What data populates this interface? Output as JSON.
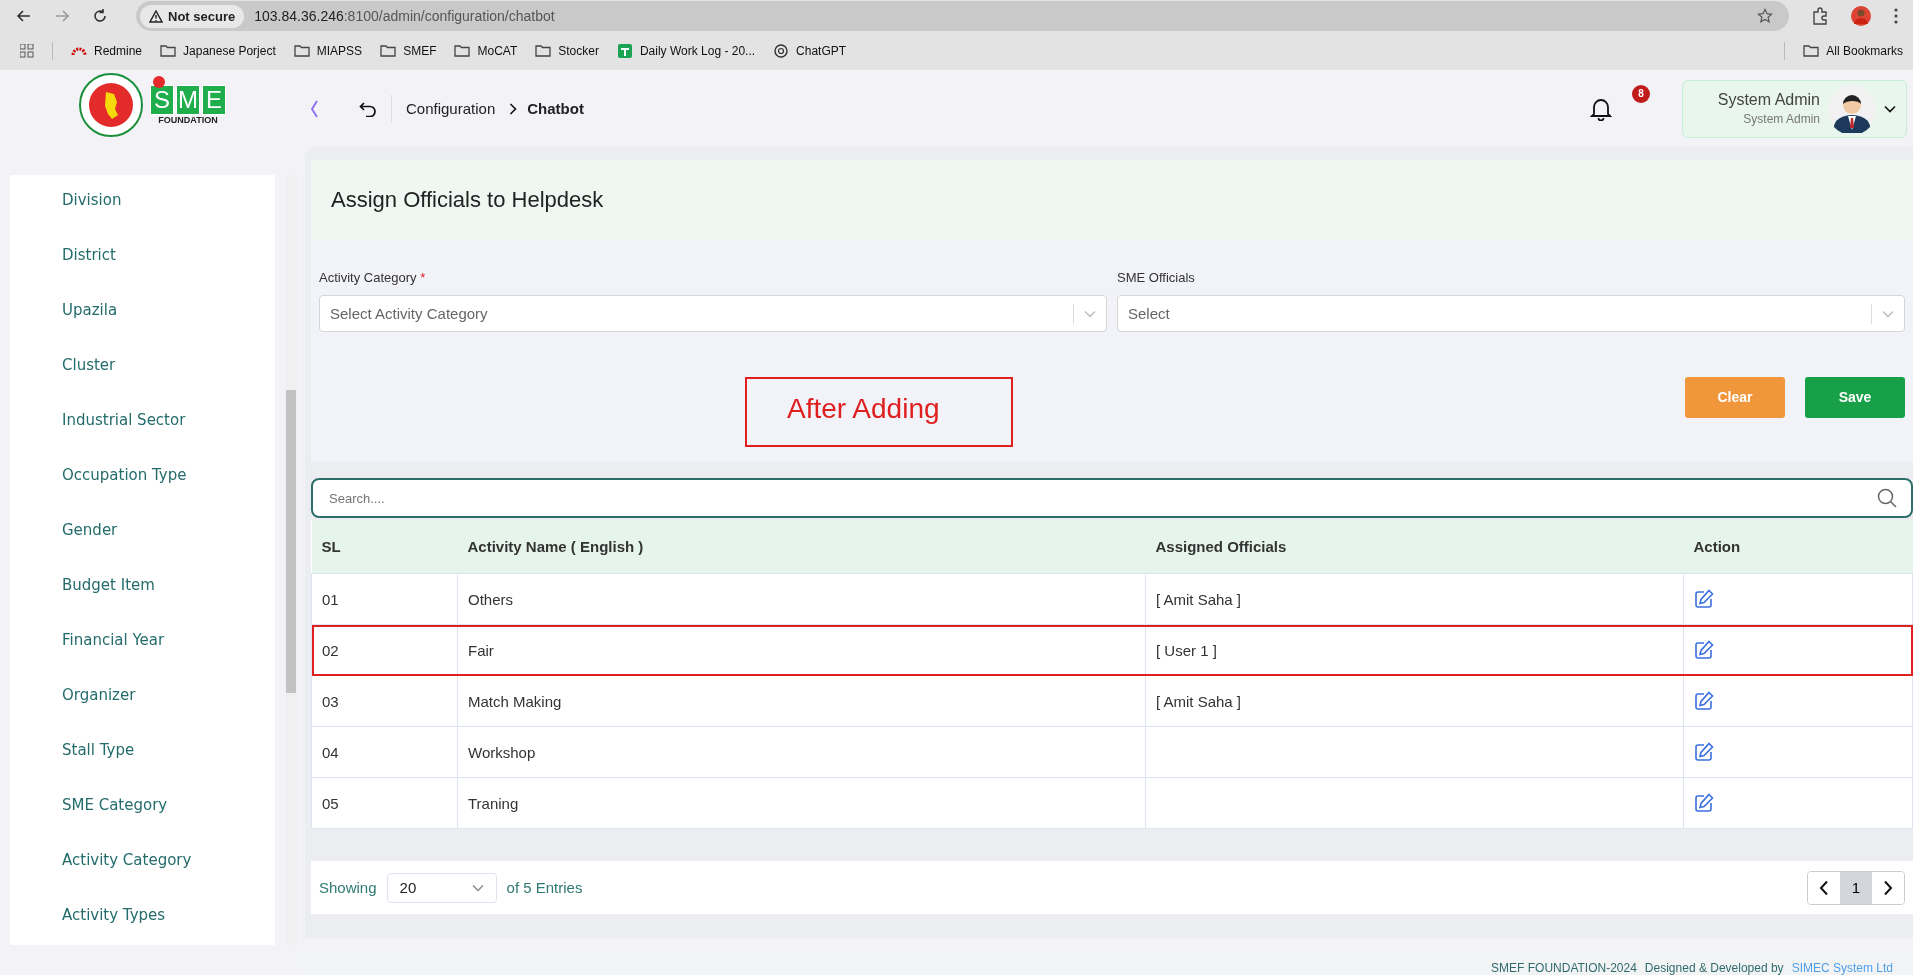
{
  "browser": {
    "security": "Not secure",
    "url_host": "103.84.36.246",
    "url_rest": ":8100/admin/configuration/chatbot",
    "bookmarks": [
      {
        "kind": "redmine",
        "label": "Redmine"
      },
      {
        "kind": "folder",
        "label": "Japanese Porject"
      },
      {
        "kind": "folder",
        "label": "MIAPSS"
      },
      {
        "kind": "folder",
        "label": "SMEF"
      },
      {
        "kind": "folder",
        "label": "MoCAT"
      },
      {
        "kind": "folder",
        "label": "Stocker"
      },
      {
        "kind": "sheet",
        "label": "Daily Work Log - 20..."
      },
      {
        "kind": "chatgpt",
        "label": "ChatGPT"
      }
    ],
    "all_bookmarks": "All Bookmarks"
  },
  "logo": {
    "letters": [
      "S",
      "M",
      "E"
    ],
    "subtitle": "FOUNDATION"
  },
  "breadcrumb": {
    "parent": "Configuration",
    "current": "Chatbot"
  },
  "notifications": {
    "count": "8"
  },
  "user": {
    "name": "System Admin",
    "role": "System Admin"
  },
  "sidebar": {
    "items": [
      {
        "label": "Division",
        "selected": false
      },
      {
        "label": "District",
        "selected": false
      },
      {
        "label": "Upazila",
        "selected": false
      },
      {
        "label": "Cluster",
        "selected": false
      },
      {
        "label": "Industrial Sector",
        "selected": false
      },
      {
        "label": "Occupation Type",
        "selected": false
      },
      {
        "label": "Gender",
        "selected": false
      },
      {
        "label": "Budget Item",
        "selected": false
      },
      {
        "label": "Financial Year",
        "selected": false
      },
      {
        "label": "Organizer",
        "selected": false
      },
      {
        "label": "Stall Type",
        "selected": false
      },
      {
        "label": "SME Category",
        "selected": false
      },
      {
        "label": "Activity Category",
        "selected": false
      },
      {
        "label": "Activity Types",
        "selected": false
      }
    ]
  },
  "page_title": "Assign Officials to Helpdesk",
  "form": {
    "fields": [
      {
        "label": "Activity Category",
        "required_mark": "*",
        "placeholder": "Select Activity Category"
      },
      {
        "label": "SME Officials",
        "placeholder": "Select"
      }
    ],
    "buttons": [
      {
        "kind": "clear",
        "label": "Clear"
      },
      {
        "kind": "save",
        "label": "Save"
      }
    ]
  },
  "annotation": {
    "text": "After Adding"
  },
  "search": {
    "placeholder": "Search...."
  },
  "table": {
    "columns": [
      "SL",
      "Activity Name ( English )",
      "Assigned Officials",
      "Action"
    ],
    "rows": [
      {
        "sl": "01",
        "activity": "Others",
        "officials": "[ Amit Saha ]",
        "highlighted": false
      },
      {
        "sl": "02",
        "activity": "Fair",
        "officials": "[ User 1 ]",
        "highlighted": true
      },
      {
        "sl": "03",
        "activity": "Match Making",
        "officials": "[ Amit Saha ]",
        "highlighted": false
      },
      {
        "sl": "04",
        "activity": "Workshop",
        "highlighted": false
      },
      {
        "sl": "05",
        "activity": "Traning",
        "highlighted": false
      }
    ]
  },
  "pagination": {
    "showing": "Showing",
    "page_size": "20",
    "entries": "of 5 Entries",
    "pages": [
      {
        "label": "1",
        "selected": true
      }
    ]
  },
  "footer": {
    "copyright": "SMEF FOUNDATION-2024",
    "designed": "Designed & Developed by",
    "company": "SIMEC System Ltd"
  }
}
